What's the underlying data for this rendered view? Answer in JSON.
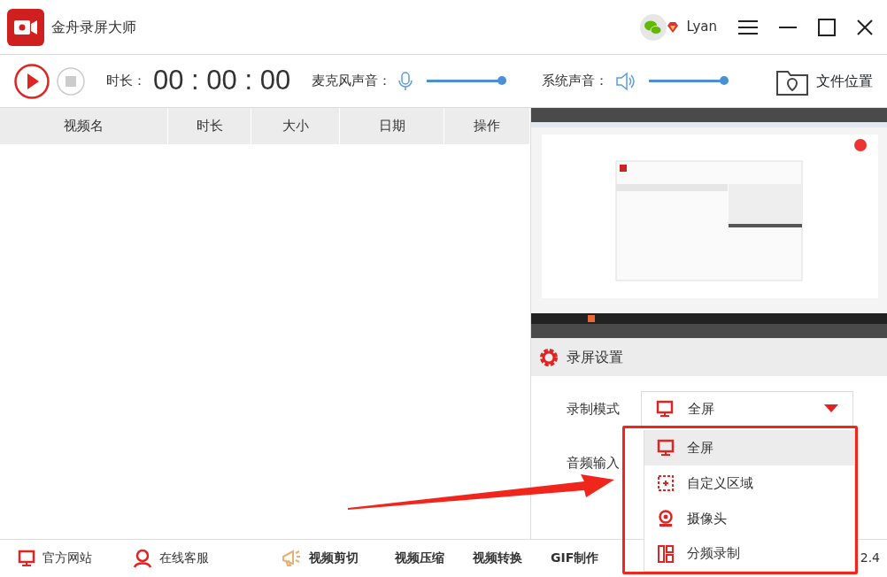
{
  "window": {
    "title": "金舟录屏大师",
    "user": "Lyan"
  },
  "toolbar": {
    "duration_label": "时长：",
    "duration": "00 : 00 : 00",
    "mic": {
      "label": "麦克风声音：",
      "level": 1.0
    },
    "system": {
      "label": "系统声音：",
      "level": 1.0
    },
    "file_location": "文件位置"
  },
  "table": {
    "columns": [
      "视频名",
      "时长",
      "大小",
      "日期",
      "操作"
    ]
  },
  "settings": {
    "title": "录屏设置",
    "mode_label": "录制模式",
    "mode_value": "全屏",
    "audio_label": "音频输入"
  },
  "dropdown": {
    "items": [
      {
        "label": "全屏",
        "kind": "fullscreen",
        "selected": true
      },
      {
        "label": "自定义区域",
        "kind": "region",
        "selected": false
      },
      {
        "label": "摄像头",
        "kind": "camera",
        "selected": false
      },
      {
        "label": "分频录制",
        "kind": "split",
        "selected": false
      }
    ]
  },
  "footer": {
    "links": [
      {
        "label": "官方网站",
        "kind": "monitor"
      },
      {
        "label": "在线客服",
        "kind": "person"
      },
      {
        "label": "视频剪切",
        "kind": "megaphone"
      },
      {
        "label": "视频压缩",
        "kind": "none"
      },
      {
        "label": "视频转换",
        "kind": "none"
      },
      {
        "label": "GIF制作",
        "kind": "none"
      }
    ],
    "version": "2.4"
  }
}
